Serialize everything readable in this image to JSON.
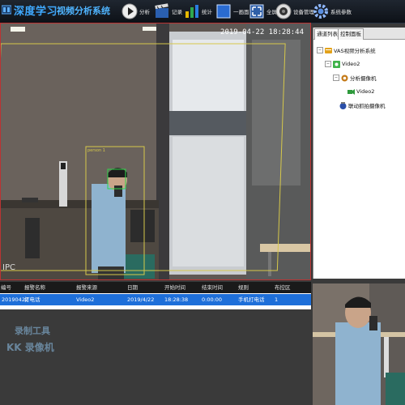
{
  "app": {
    "title": "深度学习",
    "subtitle": "视频分析系统"
  },
  "toolbar": [
    {
      "label": "分析",
      "icon": "play-icon"
    },
    {
      "label": "记录",
      "icon": "record-icon"
    },
    {
      "label": "统计",
      "icon": "chart-icon"
    },
    {
      "label": "一画面",
      "icon": "single-screen-icon"
    },
    {
      "label": "全屏",
      "icon": "fullscreen-icon"
    },
    {
      "label": "设备管理",
      "icon": "camera-icon"
    },
    {
      "label": "系统参数",
      "icon": "gear-icon"
    }
  ],
  "video": {
    "timestamp": "2019-04-22 18:28:44",
    "channel_label": "IPC",
    "detection_label": "person 1"
  },
  "panel": {
    "tabs": [
      "通道列表",
      "控制面板"
    ],
    "tree": [
      {
        "label": "VAS视频分析系统",
        "icon": "server-icon",
        "level": 0,
        "expander": "−"
      },
      {
        "label": "Video2",
        "icon": "video-folder-icon",
        "level": 1,
        "expander": "−"
      },
      {
        "label": "分析摄像机",
        "icon": "analysis-camera-icon",
        "level": 2,
        "expander": "−"
      },
      {
        "label": "Video2",
        "icon": "camera-small-icon",
        "level": 3,
        "expander": ""
      },
      {
        "label": "联动抓拍摄像机",
        "icon": "ptz-camera-icon",
        "level": 1,
        "expander": ""
      }
    ]
  },
  "alarm_table": {
    "columns": [
      "编号",
      "报警名称",
      "报警来源",
      "日期",
      "开始时间",
      "结束时间",
      "规则",
      "布控区"
    ],
    "rows": [
      [
        "20190422",
        "打电话",
        "Video2",
        "2019/4/22",
        "18:28:38",
        "0:00:00",
        "手机打电话",
        "1"
      ]
    ]
  },
  "watermark": {
    "line1": "录制工具",
    "line2": "KK 录像机"
  }
}
